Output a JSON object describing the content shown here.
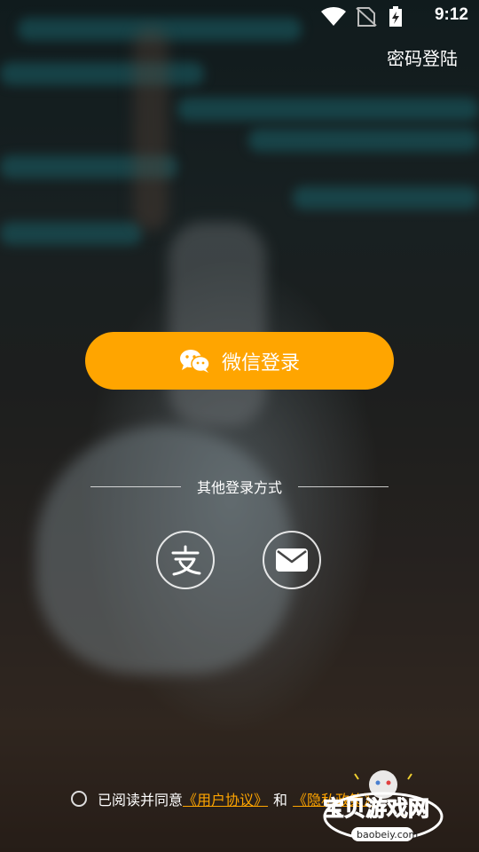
{
  "status_bar": {
    "time": "9:12",
    "icons": [
      "wifi-icon",
      "no-sim-icon",
      "battery-charging-icon"
    ]
  },
  "header": {
    "password_login": "密码登陆"
  },
  "wechat_login": {
    "label": "微信登录",
    "icon": "wechat-icon",
    "color": "#FFA500"
  },
  "other_login": {
    "label": "其他登录方式",
    "options": [
      {
        "icon": "alipay-icon"
      },
      {
        "icon": "email-icon"
      }
    ]
  },
  "agreement": {
    "prefix": "已阅读并同意",
    "user_agreement": "《用户协议》",
    "and": "和",
    "privacy_policy": "《隐私政策》",
    "link_color": "#FFA500"
  },
  "watermark": {
    "text": "宝贝游戏网",
    "url": "baobeiy.com"
  }
}
